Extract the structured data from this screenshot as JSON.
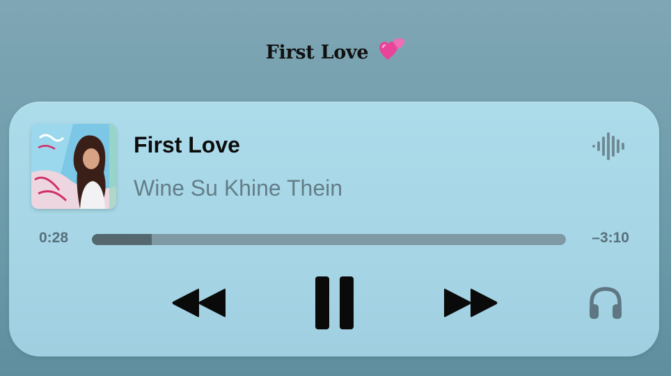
{
  "caption": {
    "title": "First Love",
    "emoji": "💕",
    "emoji_icon": "two-hearts-icon"
  },
  "player": {
    "artwork_icon": "album-artwork",
    "track_title": "First Love",
    "artist": "Wine Su Khine Thein",
    "waveform_icon": "waveform-icon",
    "elapsed": "0:28",
    "remaining": "–3:10",
    "progress_percent": 12.7,
    "controls": {
      "rewind_icon": "rewind-icon",
      "pause_icon": "pause-icon",
      "forward_icon": "fast-forward-icon",
      "output_icon": "headphones-icon"
    },
    "colors": {
      "panel": "#a9d9e8",
      "progress_track": "#7f9aa4",
      "progress_fill": "#56686f",
      "secondary_text": "#647d88"
    }
  }
}
